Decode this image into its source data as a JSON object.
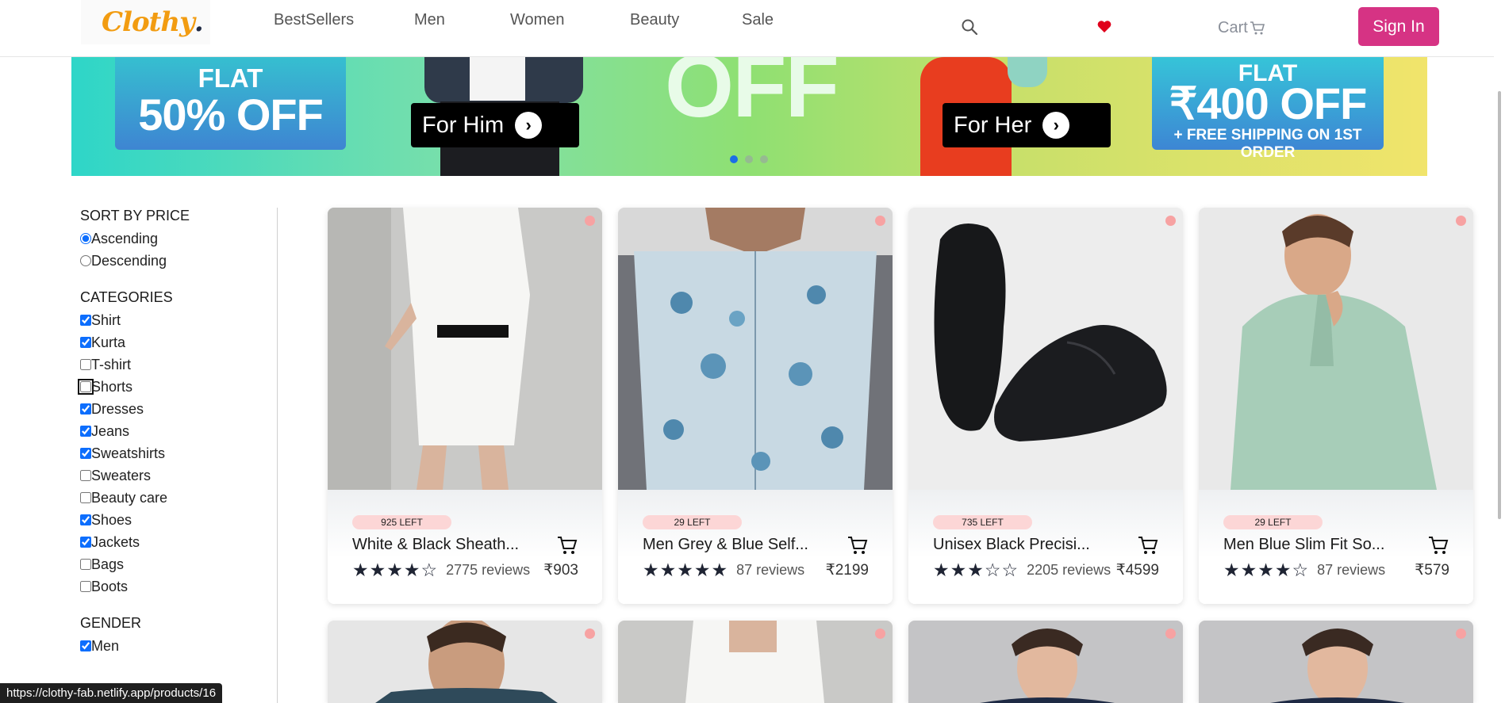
{
  "nav": {
    "logo_main": "Clothy",
    "logo_dot": ".",
    "links": [
      "BestSellers",
      "Men",
      "Women",
      "Beauty",
      "Sale"
    ],
    "cart_label": "Cart",
    "signin_label": "Sign In"
  },
  "banner": {
    "left_flat": "FLAT",
    "left_offer": "50% OFF",
    "center_offer": "OFF",
    "for_him": "For Him",
    "for_her": "For Her",
    "right_flat": "FLAT",
    "right_offer": "₹400 OFF",
    "right_shipping": "+ FREE SHIPPING ON 1ST ORDER",
    "slides": 3,
    "active_slide": 0
  },
  "filters": {
    "sort": {
      "title": "SORT BY PRICE",
      "options": [
        {
          "label": "Ascending",
          "checked": true
        },
        {
          "label": "Descending",
          "checked": false
        }
      ]
    },
    "categories": {
      "title": "CATEGORIES",
      "options": [
        {
          "label": "Shirt",
          "checked": true
        },
        {
          "label": "Kurta",
          "checked": true
        },
        {
          "label": "T-shirt",
          "checked": false
        },
        {
          "label": "Shorts",
          "checked": false
        },
        {
          "label": "Dresses",
          "checked": true
        },
        {
          "label": "Jeans",
          "checked": true
        },
        {
          "label": "Sweatshirts",
          "checked": true
        },
        {
          "label": "Sweaters",
          "checked": false
        },
        {
          "label": "Beauty care",
          "checked": false
        },
        {
          "label": "Shoes",
          "checked": true
        },
        {
          "label": "Jackets",
          "checked": true
        },
        {
          "label": "Bags",
          "checked": false
        },
        {
          "label": "Boots",
          "checked": false
        }
      ]
    },
    "gender": {
      "title": "GENDER",
      "options": [
        {
          "label": "Men",
          "checked": true
        }
      ]
    }
  },
  "products": [
    {
      "stock": "925 LEFT",
      "name": "White & Black Sheath...",
      "stars": "★★★★☆",
      "reviews": "2775 reviews",
      "price": "₹903"
    },
    {
      "stock": "29 LEFT",
      "name": "Men Grey & Blue Self...",
      "stars": "★★★★★",
      "reviews": "87 reviews",
      "price": "₹2199"
    },
    {
      "stock": "735 LEFT",
      "name": "Unisex Black Precisi...",
      "stars": "★★★☆☆",
      "reviews": "2205 reviews",
      "price": "₹4599"
    },
    {
      "stock": "29 LEFT",
      "name": "Men Blue Slim Fit So...",
      "stars": "★★★★☆",
      "reviews": "87 reviews",
      "price": "₹579"
    }
  ],
  "status_url": "https://clothy-fab.netlify.app/products/16",
  "colors": {
    "brand": "#f29c11",
    "signin": "#d63384",
    "heart": "#e0001b",
    "stock_badge": "#fcd6d6"
  }
}
